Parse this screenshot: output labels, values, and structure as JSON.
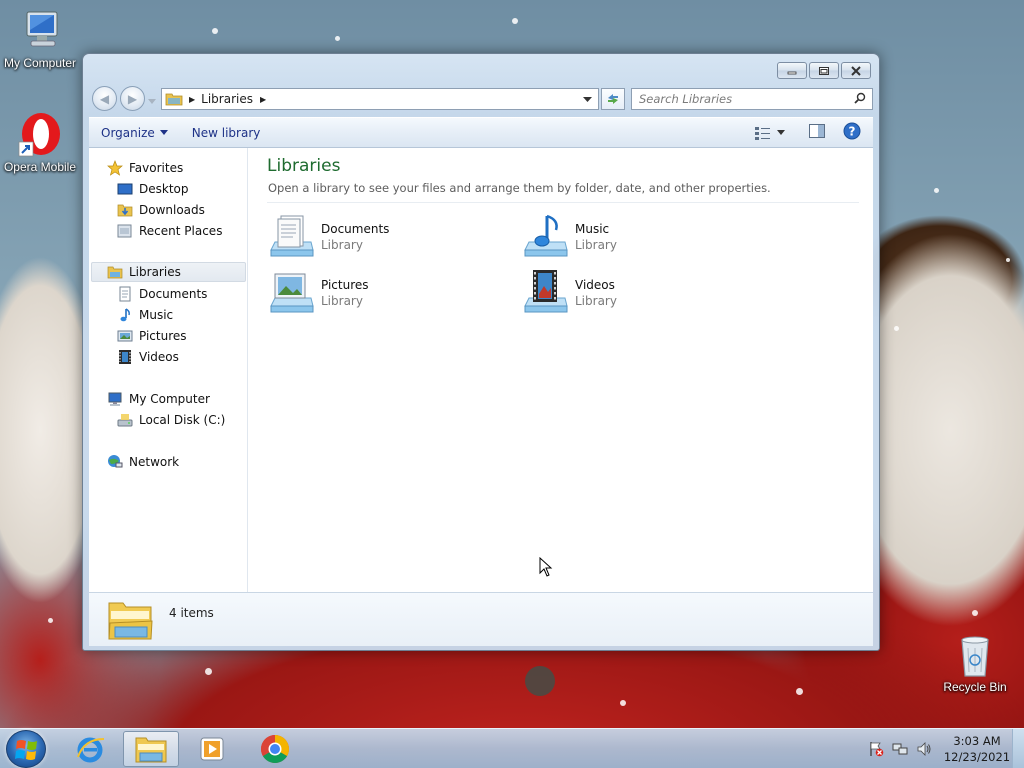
{
  "desktop": {
    "icons": {
      "my_computer": "My Computer",
      "opera": "Opera Mobile",
      "recycle_bin": "Recycle Bin"
    }
  },
  "window": {
    "address": {
      "crumb": "Libraries"
    },
    "search": {
      "placeholder": "Search Libraries"
    },
    "toolbar": {
      "organize": "Organize",
      "new_library": "New library"
    },
    "nav": {
      "favorites": "Favorites",
      "desktop": "Desktop",
      "downloads": "Downloads",
      "recent_places": "Recent Places",
      "libraries": "Libraries",
      "documents": "Documents",
      "music": "Music",
      "pictures": "Pictures",
      "videos": "Videos",
      "my_computer": "My Computer",
      "local_disk": "Local Disk (C:)",
      "network": "Network"
    },
    "content": {
      "title": "Libraries",
      "subtitle": "Open a library to see your files and arrange them by folder, date, and other properties.",
      "libraries": [
        {
          "name": "Documents",
          "type": "Library",
          "icon": "documents-library-icon"
        },
        {
          "name": "Music",
          "type": "Library",
          "icon": "music-library-icon"
        },
        {
          "name": "Pictures",
          "type": "Library",
          "icon": "pictures-library-icon"
        },
        {
          "name": "Videos",
          "type": "Library",
          "icon": "videos-library-icon"
        }
      ]
    },
    "details": {
      "count": "4 items"
    }
  },
  "taskbar": {
    "clock": {
      "time": "3:03 AM",
      "date": "12/23/2021"
    }
  },
  "colors": {
    "title_green": "#1e6b2f",
    "taskbar": "#acc5dd",
    "link_blue": "#1e3287"
  }
}
